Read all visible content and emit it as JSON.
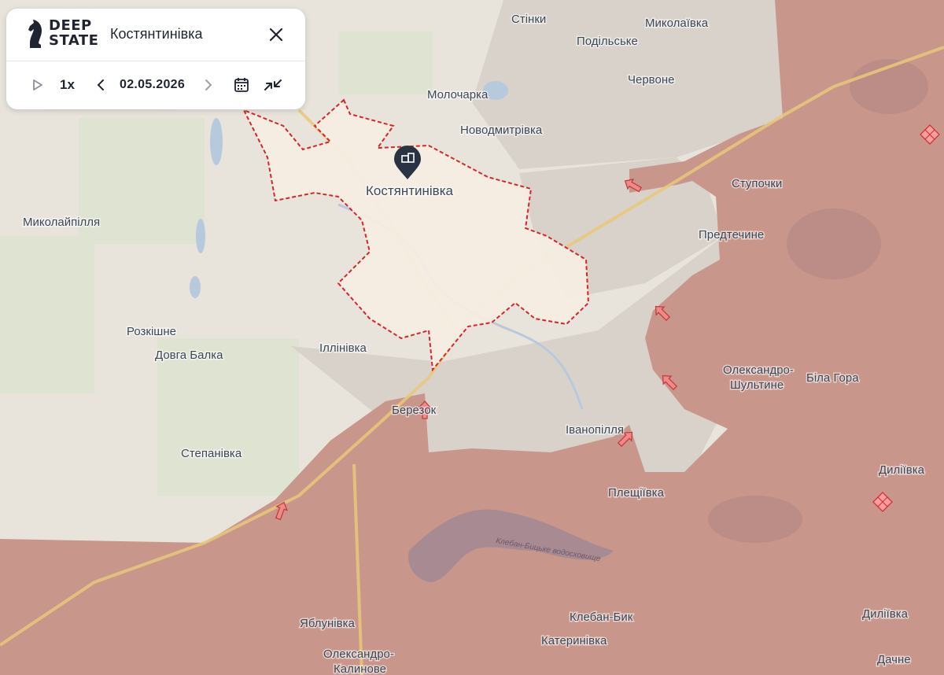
{
  "app": {
    "logo_lines": [
      "DEEP",
      "STATE"
    ],
    "title": "Костянтинівка",
    "speed": "1x",
    "date": "02.05.2026"
  },
  "icons": {
    "logo": "knight-logo-icon",
    "close": "close-icon",
    "play": "play-icon",
    "prev": "chevron-left-icon",
    "next": "chevron-right-icon",
    "calendar": "calendar-icon",
    "collapse": "collapse-arrows-icon",
    "city_marker": "city-marker-icon",
    "advance": "advance-arrow-icon",
    "strike": "strike-diamond-icon"
  },
  "colors": {
    "occupied": "#c8968c",
    "grey_zone": "#d7d0c8",
    "liberated": "#e8e4dc",
    "city_area": "#f5ece0",
    "contour": "#d6262a",
    "arrow": "#e05a5a"
  },
  "map": {
    "focus_city": "Костянтинівка",
    "places": [
      "Стінки",
      "Миколаївка",
      "Подільське",
      "Червоне",
      "Молочарка",
      "Новодмитрівка",
      "Ступочки",
      "Миколайпілля",
      "Предтечине",
      "Розкішне",
      "Довга Балка",
      "Іллінівка",
      "Олександро-",
      "Шультине",
      "Біла Гора",
      "Березок",
      "Іванопілля",
      "Степанівка",
      "Диліївка",
      "Плещіївка",
      "Клебан-Бик",
      "Яблунівка",
      "Катеринівка",
      "Диліївка",
      "Олександро-",
      "Калинове",
      "Дачне"
    ],
    "water_label": "Клебан-Бицьке водосховище"
  }
}
